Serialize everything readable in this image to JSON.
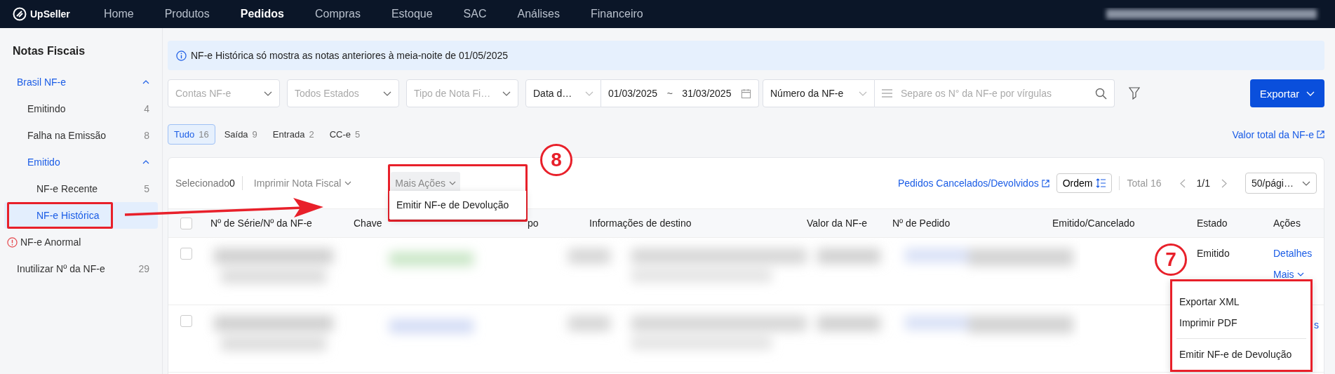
{
  "nav": {
    "brand": "UpSeller",
    "items": [
      {
        "label": "Home",
        "selected": false
      },
      {
        "label": "Produtos",
        "selected": false
      },
      {
        "label": "Pedidos",
        "selected": true
      },
      {
        "label": "Compras",
        "selected": false
      },
      {
        "label": "Estoque",
        "selected": false
      },
      {
        "label": "SAC",
        "selected": false
      },
      {
        "label": "Análises",
        "selected": false
      },
      {
        "label": "Financeiro",
        "selected": false
      }
    ]
  },
  "sidebar": {
    "title": "Notas Fiscais",
    "items": [
      {
        "label": "Brasil NF-e",
        "kind": "group",
        "expanded": true,
        "children": [
          {
            "label": "Emitindo",
            "count": "4",
            "selected": false
          },
          {
            "label": "Falha na Emissão",
            "count": "8",
            "selected": false
          },
          {
            "label": "Emitido",
            "kind": "group",
            "expanded": true,
            "children": [
              {
                "label": "NF-e Recente",
                "count": "5",
                "selected": false
              },
              {
                "label": "NF-e Histórica",
                "selected": true
              }
            ]
          }
        ]
      },
      {
        "label": "NF-e Anormal",
        "kind": "warning",
        "selected": false
      },
      {
        "label": "Inutilizar Nº da NF-e",
        "count": "29",
        "selected": false
      }
    ]
  },
  "notice": "NF-e Histórica só mostra as notas anteriores à meia-noite de 01/05/2025",
  "filters": {
    "selects": [
      {
        "placeholder": "Contas NF-e"
      },
      {
        "placeholder": "Todos Estados"
      },
      {
        "placeholder": "Tipo de Nota Fi…"
      }
    ],
    "date": {
      "type": "Data d…",
      "start": "01/03/2025",
      "separator": "~",
      "end": "31/03/2025"
    },
    "search": {
      "field": "Número da NF-e",
      "placeholder": "Separe os N° da NF-e por vírgulas"
    },
    "export": "Exportar"
  },
  "tabs": [
    {
      "label": "Tudo",
      "count": "16",
      "selected": true
    },
    {
      "label": "Saída",
      "count": "9",
      "selected": false
    },
    {
      "label": "Entrada",
      "count": "2",
      "selected": false
    },
    {
      "label": "CC-e",
      "count": "5",
      "selected": false
    }
  ],
  "total_value_link": "Valor total da NF-e",
  "toolbar": {
    "selected_label": "Selecionado",
    "selected_count": "0",
    "print": "Imprimir Nota Fiscal",
    "more": "Mais Ações",
    "more_menu": [
      "Emitir NF-e de Devolução"
    ],
    "cancelled_link": "Pedidos Cancelados/Devolvidos",
    "sort": "Ordem",
    "total": "Total 16",
    "page": "1/1",
    "page_size": "50/pági…"
  },
  "table": {
    "all_checked": false,
    "columns": [
      "Nº de Série/Nº da NF-e",
      "Chave",
      "po",
      "Informações de destino",
      "Valor da NF-e",
      "Nº de Pedido",
      "Emitido/Cancelado",
      "Estado",
      "Ações"
    ],
    "rows": [
      {
        "state": "Emitido",
        "details": "Detalhes",
        "more": "Mais",
        "checked": false
      },
      {
        "details": "s",
        "checked": false
      }
    ],
    "row_menu": [
      {
        "label": "Exportar XML",
        "divider": false
      },
      {
        "label": "Imprimir PDF",
        "divider": false
      },
      {
        "label": "Emitir NF-e de Devolução",
        "divider": true
      }
    ]
  },
  "annotations": [
    {
      "label": "8"
    },
    {
      "label": "7"
    }
  ]
}
